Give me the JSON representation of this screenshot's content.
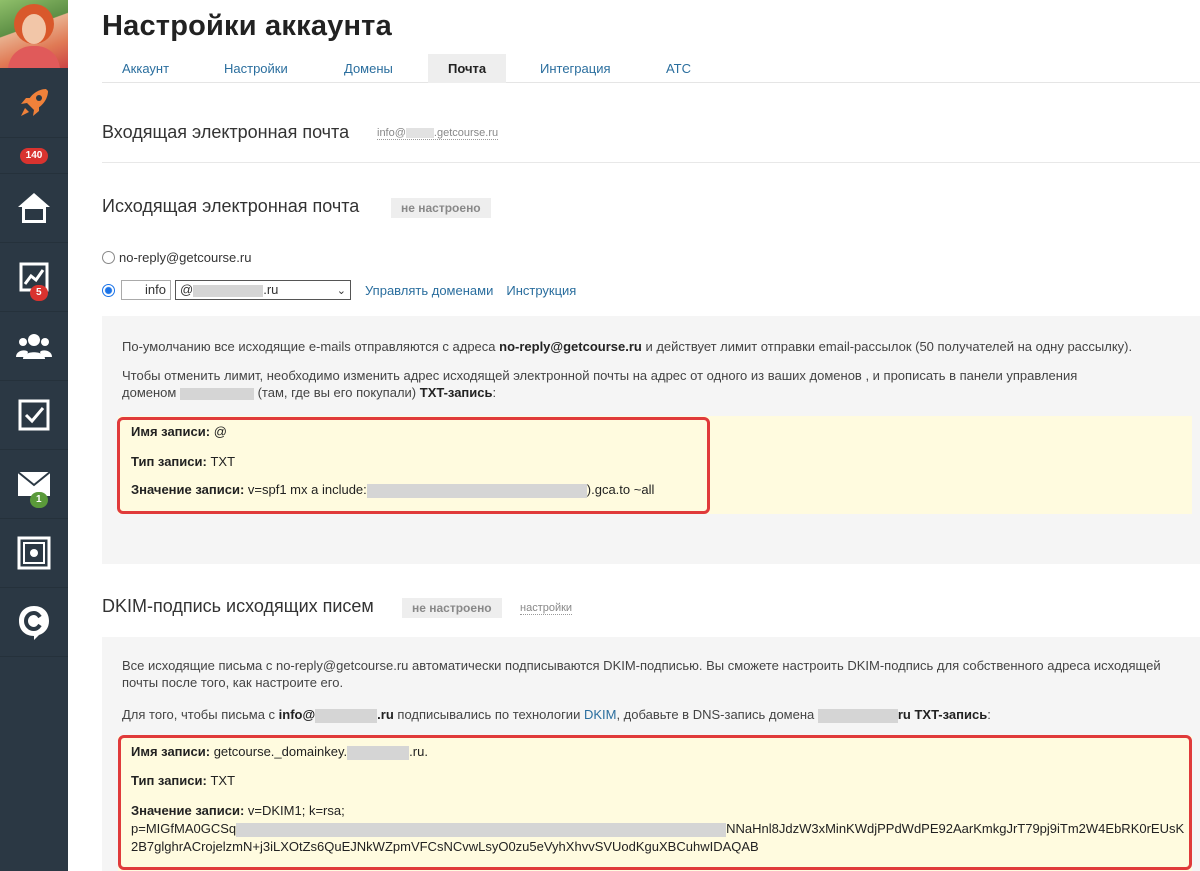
{
  "sidebar": {
    "badges": {
      "top": "140",
      "analytics": "5",
      "mail": "1"
    }
  },
  "page": {
    "title": "Настройки аккаунта"
  },
  "tabs": [
    {
      "label": "Аккаунт"
    },
    {
      "label": "Настройки"
    },
    {
      "label": "Домены"
    },
    {
      "label": "Почта"
    },
    {
      "label": "Интеграция"
    },
    {
      "label": "АТС"
    }
  ],
  "incoming": {
    "title": "Входящая электронная почта",
    "email_prefix": "info@",
    "email_suffix": ".getcourse.ru"
  },
  "outgoing": {
    "title": "Исходящая электронная почта",
    "status": "не настроено",
    "option1_label": "no-reply@getcourse.ru",
    "local_part_value": "info",
    "domain_prefix": "@",
    "domain_suffix": ".ru",
    "manage_domains_link": "Управлять доменами",
    "instruction_link": "Инструкция",
    "info_p1_a": "По-умолчанию все исходящие e-mails отправляются с адреса ",
    "info_p1_b": "no-reply@getcourse.ru",
    "info_p1_c": " и действует лимит отправки email-рассылок (50 получателей на одну рассылку).",
    "info_p2_line1": "Чтобы отменить лимит, необходимо изменить адрес исходящей электронной почты на адрес от одного из ваших доменов   , и прописать в панели управления",
    "info_p2_line2_a": "доменом",
    "info_p2_line2_b": " (там, где вы его покупали) ",
    "info_p2_line2_c": "TXT-запись",
    "info_p2_line2_d": ":",
    "record_name_label": "Имя записи:",
    "record_name_value": "@",
    "record_type_label": "Тип записи:",
    "record_type_value": "TXT",
    "record_value_label": "Значение записи:",
    "record_value_a": "v=spf1 mx a include:",
    "record_value_b": ").gca.to ~all"
  },
  "dkim": {
    "title": "DKIM-подпись исходящих писем",
    "status": "не настроено",
    "settings_link": "настройки",
    "p1_line1": "Все исходящие письма с no-reply@getcourse.ru автоматически подписываются DKIM-подписью. Вы сможете настроить DKIM-подпись для собственного адреса исходящей",
    "p1_line2": "почты после того, как настроите его.",
    "p2_a": "Для того, чтобы письма с ",
    "p2_b": "info@",
    "p2_c": ".ru",
    "p2_d": " подписывались по технологии ",
    "p2_link": "DKIM",
    "p2_e": ", добавьте в DNS-запись домена ",
    "p2_f": "ru TXT-запись",
    "p2_g": ":",
    "record_name_label": "Имя записи:",
    "record_name_a": "getcourse._domainkey.",
    "record_name_b": ".ru.",
    "record_type_label": "Тип записи:",
    "record_type_value": "TXT",
    "record_value_label": "Значение записи:",
    "record_value_line1": "v=DKIM1; k=rsa;",
    "record_value_line2_a": "p=MIGfMA0GCSq",
    "record_value_line2_b": "NNaHnl8JdzW3xMinKWdjPPdWdPE92AarKmkgJrT79pj9iTm2W4EbRK0rEUsK",
    "record_value_line3": "2B7glghrACrojelzmN+j3iLXOtZs6QuEJNkWZpmVFCsNCvwLsyO0zu5eVyhXhvvSVUodKguXBCuhwIDAQAB"
  }
}
